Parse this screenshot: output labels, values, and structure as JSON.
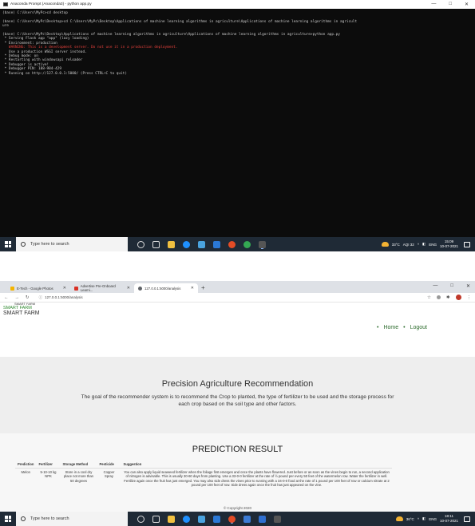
{
  "top_screen": {
    "window_title": "Anaconda Prompt (Anaconda3) - python  app.py",
    "window_controls": [
      "—",
      "□",
      "✕"
    ],
    "console_lines": [
      {
        "text": "(base) C:\\Users\\MyPc>cd desktop",
        "kind": "normal"
      },
      {
        "text": "",
        "kind": "normal"
      },
      {
        "text": "(base) C:\\Users\\MyPc\\Desktop>cd C:\\Users\\MyPc\\Desktop\\Applications of machine learning algorithms in agriculture\\Applications of machine learning algorithms in agricult",
        "kind": "normal"
      },
      {
        "text": "ure",
        "kind": "normal"
      },
      {
        "text": "",
        "kind": "normal"
      },
      {
        "text": "(base) C:\\Users\\MyPc\\Desktop\\Applications of machine learning algorithms in agriculture\\Applications of machine learning algorithms in agriculture>python app.py",
        "kind": "normal"
      },
      {
        "text": " * Serving Flask app \"app\" (lazy loading)",
        "kind": "normal"
      },
      {
        "text": " * Environment: production",
        "kind": "normal"
      },
      {
        "text": "   WARNING: This is a development server. Do not use it in a production deployment.",
        "kind": "warn"
      },
      {
        "text": "   Use a production WSGI server instead.",
        "kind": "normal"
      },
      {
        "text": " * Debug mode: on",
        "kind": "normal"
      },
      {
        "text": " * Restarting with windowsapi reloader",
        "kind": "normal"
      },
      {
        "text": " * Debugger is active!",
        "kind": "normal"
      },
      {
        "text": " * Debugger PIN: 188-984-429",
        "kind": "normal"
      },
      {
        "text": " * Running on http://127.0.0.1:5000/ (Press CTRL+C to quit)",
        "kind": "normal"
      }
    ],
    "taskbar": {
      "search_placeholder": "Type here to search",
      "weather": "33°C",
      "aqi": "AQI 32",
      "lang": "ENG",
      "time": "15:09",
      "date": "10-07-2021"
    }
  },
  "bottom_screen": {
    "tabs": [
      {
        "label": "E-Tech - Google Photos",
        "color": "#f4b400"
      },
      {
        "label": "Advertise Pre-Onboard Learni...",
        "color": "#d93025"
      },
      {
        "label": "127.0.0.1:5000/analysis",
        "color": "#5f6368"
      }
    ],
    "new_tab": "+",
    "window_controls": [
      "—",
      "□",
      "✕"
    ],
    "address": "127.0.0.1:5000/analysis",
    "site": {
      "logo_text": "SMART FARM",
      "brand_small": "SMART FARM",
      "brand_big": "SMART FARM",
      "nav": [
        {
          "label": "Home"
        },
        {
          "label": "Logout"
        }
      ],
      "hero_title": "Precision Agriculture Recommendation",
      "hero_text": "The goal of the recommender system is to recommend the Crop to planted, the type of fertilizer to be used and the storage process for each crop based on the soil type and other factors.",
      "result_title": "PREDICTION RESULT",
      "table_headers": [
        "Prediction",
        "Fertilizer",
        "Storage Method",
        "Pesticide",
        "Suggestion"
      ],
      "table_rows": [
        {
          "prediction": "Melon",
          "fertilizer": "5-10-10 kg NPK",
          "storage": "Store in a cool dry place not more than 50 degrees",
          "pesticide": "Copper Spray",
          "suggestion": "You can also apply liquid seaweed fertilizer when the foliage first emerges and once the plants have flowered. Just before or as soon as the vines begin to run, a second application of nitrogen is advisable. This is usually 30-60 days from planting. Use a 33-0-0 fertilizer at the rate of ½ pound per every 50 feet of the watermelon row. Water the fertilizer in well. Fertilize again once the fruit has just emerged. You may also side dress the vines prior to running with a 34-0-0 food at the rate of 1 pound per 100 feet of row or calcium nitrate at 2 pound per 100 feet of row. Side dress again once the fruit has just appeared on the vine."
        }
      ],
      "copyright": "© Copyright 2020"
    },
    "taskbar": {
      "search_placeholder": "Type here to search",
      "weather": "36°C",
      "lang": "ENG",
      "time": "18:11",
      "date": "10-07-2021"
    }
  }
}
